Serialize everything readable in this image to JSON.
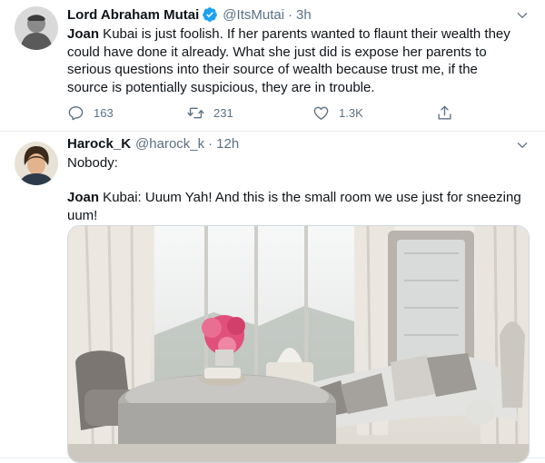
{
  "tweets": [
    {
      "name": "Lord Abraham Mutai",
      "handle": "@ItsMutai",
      "dot": "·",
      "time": "3h",
      "text_bold": "Joan",
      "text_rest": " Kubai is just foolish. If her parents wanted to flaunt their wealth they could have done it already. What she just did is expose her parents to serious questions into their source of wealth because trust me, if the source is potentially suspicious, they are in trouble.",
      "replies": "163",
      "retweets": "231",
      "likes": "1.3K"
    },
    {
      "name": "Harock_K",
      "handle": "@harock_k",
      "dot": "·",
      "time": "12h",
      "line1": "Nobody:",
      "text_bold": "Joan",
      "text_rest": " Kubai: Uuum Yah! And this is the small room we use just for sneezing uum!"
    }
  ],
  "colors": {
    "verified": "#1da1f2",
    "secondary": "#5b7083",
    "border": "#e6ecf0"
  },
  "icons": [
    "verified-badge-icon",
    "chevron-down-icon",
    "reply-icon",
    "retweet-icon",
    "like-icon",
    "share-icon"
  ]
}
